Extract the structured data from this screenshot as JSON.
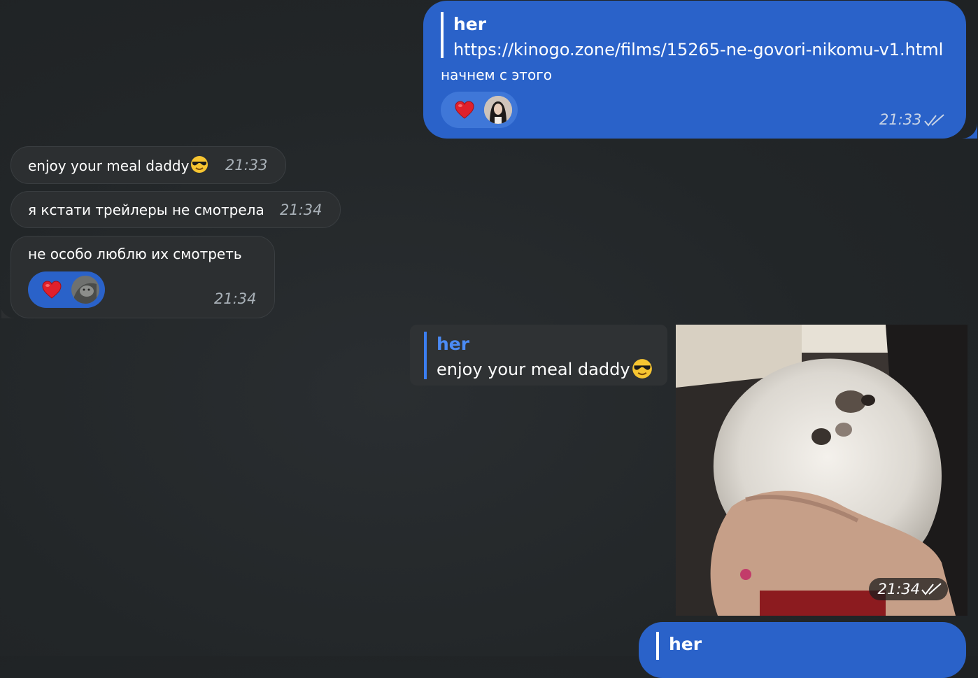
{
  "messages": {
    "m1": {
      "quote_name": "her",
      "quote_text": "https://kinogo.zone/films/15265-ne-govori-nikomu-v1.html",
      "text": "начнем с этого",
      "time": "21:33",
      "reaction": "heart"
    },
    "m2": {
      "text": "enjoy your meal daddy",
      "emoji": "sunglasses-emoji",
      "time": "21:33"
    },
    "m3": {
      "text": "я кстати трейлеры не смотрела",
      "time": "21:34"
    },
    "m4": {
      "text": "не особо люблю их смотреть",
      "time": "21:34",
      "reaction": "heart"
    },
    "m5": {
      "quote_name": "her",
      "quote_text": "enjoy your meal daddy",
      "emoji": "sunglasses-emoji",
      "time": "21:34",
      "media": "kitten-photo"
    },
    "m6": {
      "quote_name": "her"
    }
  },
  "colors": {
    "outgoing_bubble": "#2a62c9",
    "incoming_bubble": "#2c2f31",
    "background": "#222628",
    "accent_blue": "#4b8bf5"
  }
}
